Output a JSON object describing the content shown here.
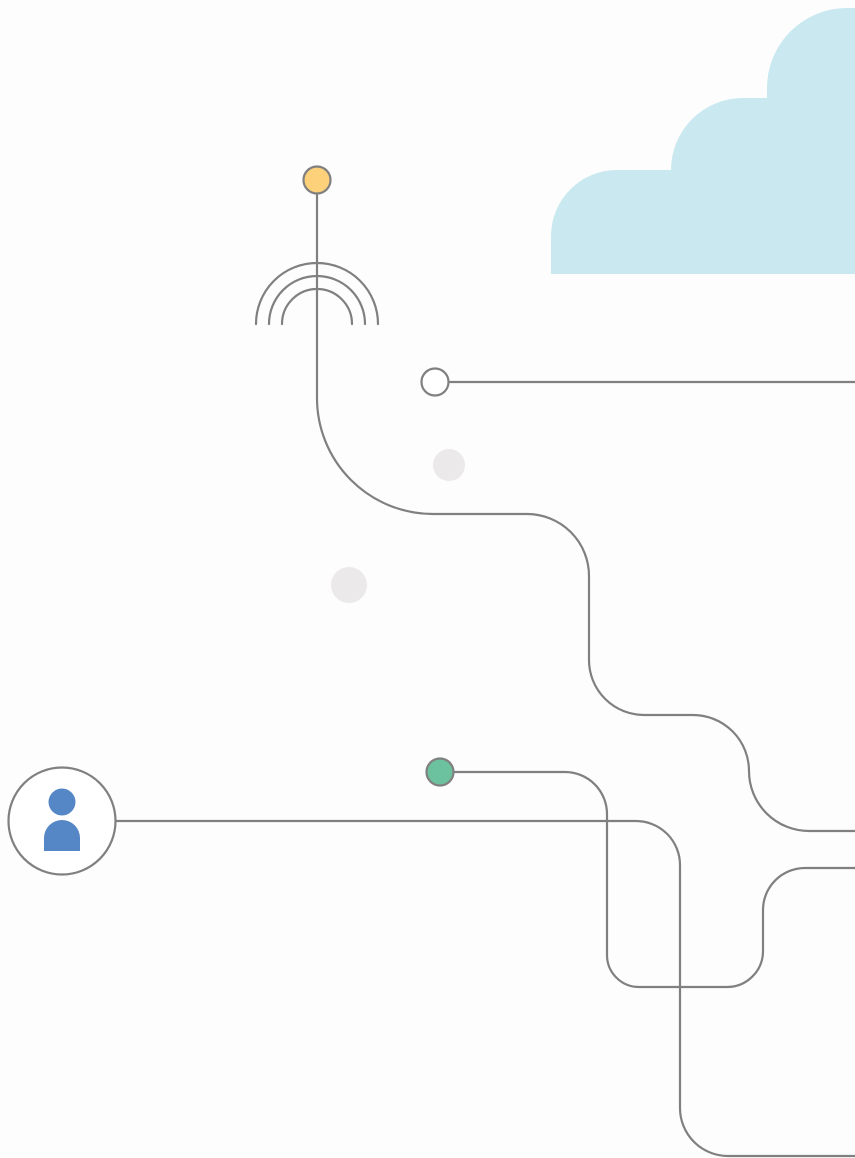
{
  "colors": {
    "background": "#fdfdfd",
    "line": "#808080",
    "cloud": "#c9e8f0",
    "node_yellow": "#fdd07a",
    "node_white": "#ffffff",
    "node_green": "#6cc19e",
    "faint_dot": "#ebe9e9",
    "user_icon": "#5586c6",
    "user_ring_fill": "#ffffff"
  },
  "icons": {
    "cloud": "cloud-icon",
    "signal": "wireless-signal-icon",
    "user": "user-icon"
  },
  "nodes": [
    {
      "name": "tower-node",
      "color": "node_yellow"
    },
    {
      "name": "outline-node",
      "color": "node_white"
    },
    {
      "name": "green-node",
      "color": "node_green"
    }
  ]
}
